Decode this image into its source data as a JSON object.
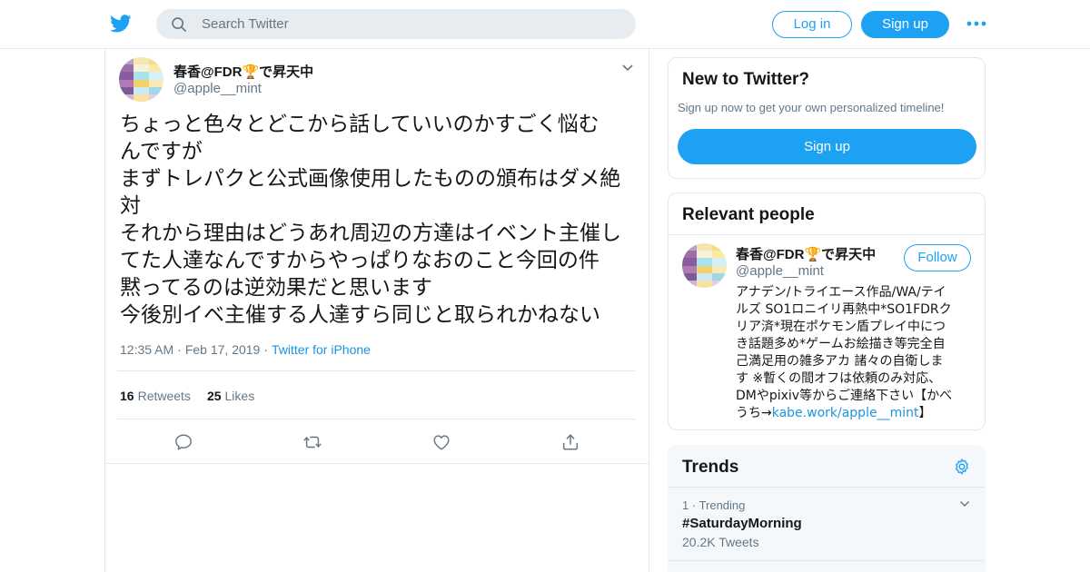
{
  "header": {
    "search_placeholder": "Search Twitter",
    "login_label": "Log in",
    "signup_label": "Sign up"
  },
  "tweet": {
    "author_name": "春香@FDR🏆で昇天中",
    "author_handle": "@apple__mint",
    "text_lines": [
      "ちょっと色々とどこから話していいのかすごく悩む",
      "んですが",
      "まずトレパクと公式画像使用したものの頒布はダメ絶",
      "対",
      "それから理由はどうあれ周辺の方達はイベント主催し",
      "てた人達なんですからやっぱりなおのこと今回の件",
      "黙ってるのは逆効果だと思います",
      "今後別イベ主催する人達すら同じと取られかねない"
    ],
    "time": "12:35 AM",
    "date": "Feb 17, 2019",
    "source": "Twitter for iPhone",
    "retweets_count": "16",
    "retweets_label": "Retweets",
    "likes_count": "25",
    "likes_label": "Likes"
  },
  "sidebar": {
    "new_to_twitter": {
      "title": "New to Twitter?",
      "subtitle": "Sign up now to get your own personalized timeline!",
      "button": "Sign up"
    },
    "relevant_people": {
      "title": "Relevant people",
      "name": "春香@FDR🏆で昇天中",
      "handle": "@apple__mint",
      "follow_label": "Follow",
      "bio_lines": [
        "アナデン/トライエース作品/WA/テイ",
        "ルズ SO1ロニイリ再熱中*SO1FDRク",
        "リア済*現在ポケモン盾プレイ中につ",
        "き話題多め*ゲームお絵描き等完全自",
        "己満足用の雑多アカ 諸々の自衛しま",
        "す ※暫くの間オフは依頼のみ対応、",
        "DMやpixiv等からご連絡下さい【かべ"
      ],
      "bio_last_prefix": "うち→",
      "bio_link": "kabe.work/apple__mint",
      "bio_last_suffix": "】"
    },
    "trends": {
      "title": "Trends",
      "items": [
        {
          "rank": "1",
          "label": "Trending",
          "tag": "#SaturdayMorning",
          "count": "20.2K Tweets"
        }
      ]
    }
  },
  "colors": {
    "accent": "#1da1f2",
    "link": "#1b95e0",
    "muted": "#657786",
    "border": "#e1e8ed"
  },
  "icons": [
    "twitter-bird-icon",
    "search-icon",
    "more-icon",
    "caret-down-icon",
    "reply-icon",
    "retweet-icon",
    "like-icon",
    "share-icon",
    "gear-icon"
  ]
}
